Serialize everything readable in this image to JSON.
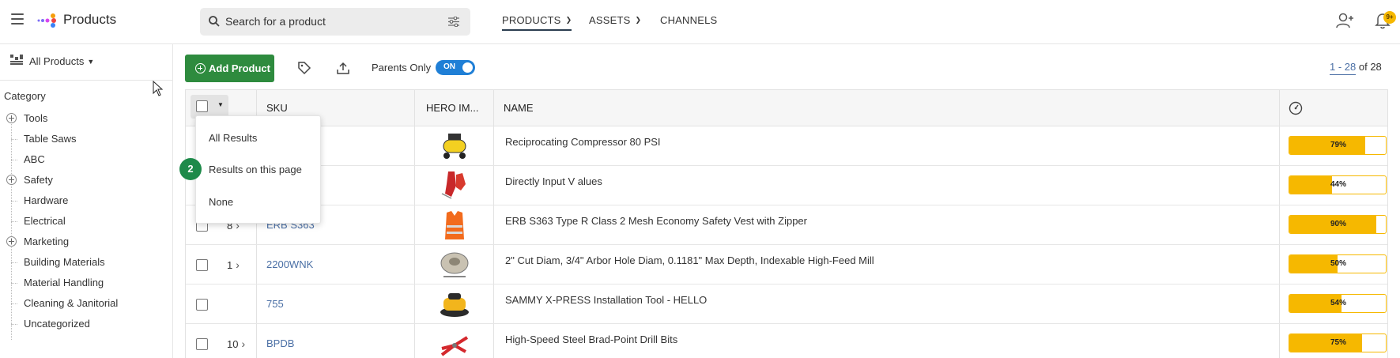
{
  "header": {
    "app_title": "Products",
    "search_placeholder": "Search for a product",
    "nav": [
      {
        "label": "PRODUCTS",
        "has_menu": true,
        "active": true
      },
      {
        "label": "ASSETS",
        "has_menu": true,
        "active": false
      },
      {
        "label": "CHANNELS",
        "has_menu": false,
        "active": false
      }
    ],
    "notification_badge": "9+",
    "icons": [
      "menu-icon",
      "logo-icon",
      "search-icon",
      "filter-icon",
      "add-user-icon",
      "bell-icon"
    ]
  },
  "sidebar": {
    "selector_label": "All Products",
    "category_title": "Category",
    "tree": [
      {
        "label": "Tools",
        "expandable": true
      },
      {
        "label": "Table Saws",
        "expandable": false
      },
      {
        "label": "ABC",
        "expandable": false
      },
      {
        "label": "Safety",
        "expandable": true
      },
      {
        "label": "Hardware",
        "expandable": false
      },
      {
        "label": "Electrical",
        "expandable": false
      },
      {
        "label": "Marketing",
        "expandable": true
      },
      {
        "label": "Building Materials",
        "expandable": false
      },
      {
        "label": "Material Handling",
        "expandable": false
      },
      {
        "label": "Cleaning & Janitorial",
        "expandable": false
      },
      {
        "label": "Uncategorized",
        "expandable": false
      }
    ]
  },
  "toolbar": {
    "add_label": "Add Product",
    "parents_label": "Parents Only",
    "toggle_label": "ON",
    "pager_range": "1 - 28",
    "pager_of": "of 28"
  },
  "table": {
    "columns": [
      "SKU",
      "HERO IM...",
      "NAME"
    ],
    "rows": [
      {
        "count": "",
        "sku": "",
        "name": "Reciprocating Compressor 80 PSI",
        "pct": "79%",
        "fill": 0.79,
        "image": "air-compressor"
      },
      {
        "count": "",
        "sku": "",
        "name": "Directly Input V alues",
        "pct": "44%",
        "fill": 0.44,
        "image": "red-gloves"
      },
      {
        "count": "8",
        "sku": "ERB S363",
        "name": "ERB S363 Type R Class 2 Mesh Economy Safety Vest with Zipper",
        "pct": "90%",
        "fill": 0.9,
        "image": "safety-vest"
      },
      {
        "count": "1",
        "sku": "2200WNK",
        "name": "2\" Cut Diam, 3/4\" Arbor Hole Diam, 0.1181\" Max Depth, Indexable High-Feed Mill",
        "pct": "50%",
        "fill": 0.5,
        "image": "milling-cutter"
      },
      {
        "count": "",
        "sku": "755",
        "name": "SAMMY X-PRESS Installation Tool - HELLO",
        "pct": "54%",
        "fill": 0.54,
        "image": "orbital-sander"
      },
      {
        "count": "10",
        "sku": "BPDB",
        "name": "High-Speed Steel Brad-Point Drill Bits",
        "pct": "75%",
        "fill": 0.75,
        "image": "pliers"
      }
    ]
  },
  "select_menu": {
    "items": [
      "All Results",
      "Results on this page",
      "None"
    ],
    "step_badge": "2"
  }
}
